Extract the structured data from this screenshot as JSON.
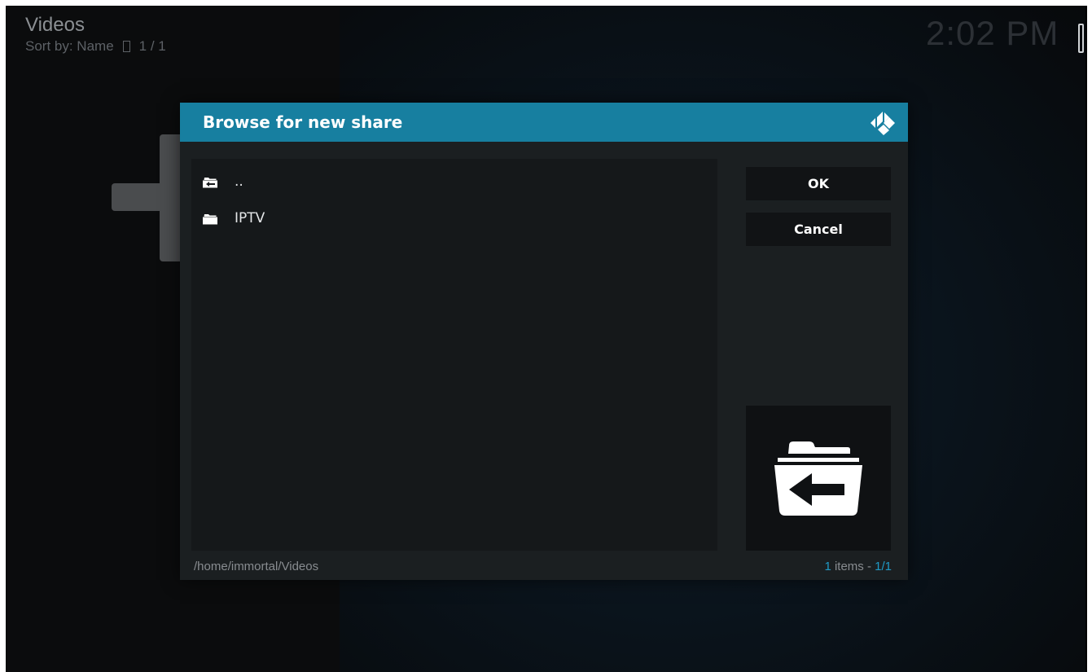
{
  "window": {
    "title": "Videos",
    "sort_label": "Sort by: Name",
    "page_indicator": "1 / 1",
    "clock": "2:02 PM"
  },
  "dialog": {
    "title": "Browse for new share",
    "logo_icon": "kodi-logo-icon",
    "items": [
      {
        "label": "..",
        "icon": "folder-back-icon"
      },
      {
        "label": "IPTV",
        "icon": "folder-icon"
      }
    ],
    "buttons": {
      "ok": "OK",
      "cancel": "Cancel"
    },
    "thumbnail_icon": "folder-back-icon",
    "footer": {
      "path": "/home/immortal/Videos",
      "count_number": "1",
      "count_text": " items - ",
      "page": "1/1"
    }
  },
  "colors": {
    "header": "#177fa0",
    "accent": "#1f9ac6",
    "dialog_bg": "#1b1f21",
    "list_bg": "#15181a"
  }
}
